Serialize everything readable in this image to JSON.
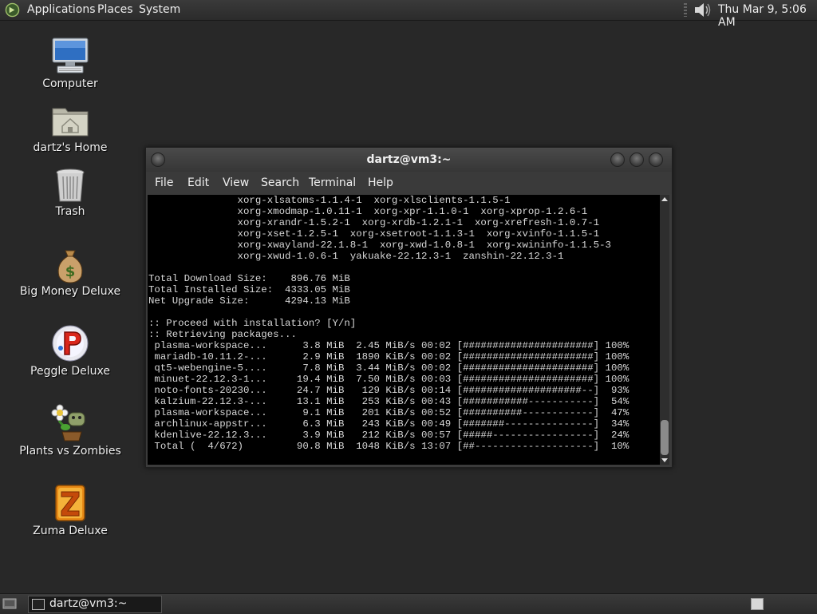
{
  "top_panel": {
    "applications": "Applications",
    "places": "Places",
    "system": "System",
    "clock": "Thu Mar  9,  5:06 AM"
  },
  "desktop_icons": [
    {
      "label": "Computer",
      "icon": "computer-icon"
    },
    {
      "label": "dartz's Home",
      "icon": "home-folder-icon"
    },
    {
      "label": "Trash",
      "icon": "trash-icon"
    },
    {
      "label": "Big Money Deluxe",
      "icon": "money-bag-icon"
    },
    {
      "label": "Peggle Deluxe",
      "icon": "peggle-icon"
    },
    {
      "label": "Plants vs Zombies",
      "icon": "plants-vs-zombies-icon"
    },
    {
      "label": "Zuma Deluxe",
      "icon": "zuma-icon"
    }
  ],
  "terminal": {
    "title": "dartz@vm3:~",
    "menu": [
      "File",
      "Edit",
      "View",
      "Search",
      "Terminal",
      "Help"
    ],
    "lines": [
      "               xorg-xlsatoms-1.1.4-1  xorg-xlsclients-1.1.5-1",
      "               xorg-xmodmap-1.0.11-1  xorg-xpr-1.1.0-1  xorg-xprop-1.2.6-1",
      "               xorg-xrandr-1.5.2-1  xorg-xrdb-1.2.1-1  xorg-xrefresh-1.0.7-1",
      "               xorg-xset-1.2.5-1  xorg-xsetroot-1.1.3-1  xorg-xvinfo-1.1.5-1",
      "               xorg-xwayland-22.1.8-1  xorg-xwd-1.0.8-1  xorg-xwininfo-1.1.5-3",
      "               xorg-xwud-1.0.6-1  yakuake-22.12.3-1  zanshin-22.12.3-1",
      "",
      "Total Download Size:    896.76 MiB",
      "Total Installed Size:  4333.05 MiB",
      "Net Upgrade Size:      4294.13 MiB",
      "",
      ":: Proceed with installation? [Y/n]",
      ":: Retrieving packages...",
      " plasma-workspace...      3.8 MiB  2.45 MiB/s 00:02 [######################] 100%",
      " mariadb-10.11.2-...      2.9 MiB  1890 KiB/s 00:02 [######################] 100%",
      " qt5-webengine-5....      7.8 MiB  3.44 MiB/s 00:02 [######################] 100%",
      " minuet-22.12.3-1...     19.4 MiB  7.50 MiB/s 00:03 [######################] 100%",
      " noto-fonts-20230...     24.7 MiB   129 KiB/s 00:14 [####################--]  93%",
      " kalzium-22.12.3-...     13.1 MiB   253 KiB/s 00:43 [###########-----------]  54%",
      " plasma-workspace...      9.1 MiB   201 KiB/s 00:52 [##########------------]  47%",
      " archlinux-appstr...      6.3 MiB   243 KiB/s 00:49 [#######---------------]  34%",
      " kdenlive-22.12.3...      3.9 MiB   212 KiB/s 00:57 [#####-----------------]  24%",
      " Total (  4/672)         90.8 MiB  1048 KiB/s 13:07 [##--------------------]  10%"
    ]
  },
  "taskbar": {
    "terminal_button": "dartz@vm3:~"
  }
}
